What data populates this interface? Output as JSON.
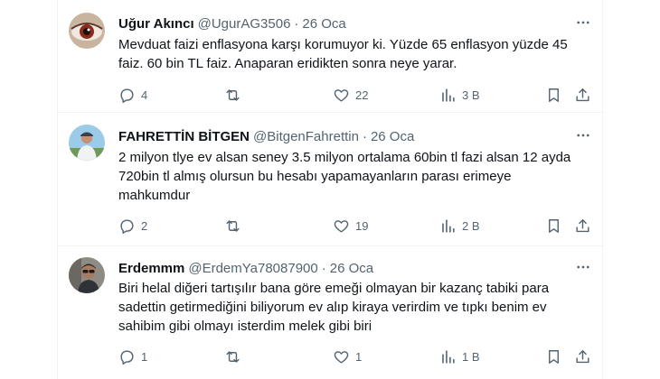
{
  "tweets": [
    {
      "name": "Uğur Akıncı",
      "handle": "@UgurAG3506",
      "time": "26 Oca",
      "text": "Mevduat faizi enflasyona karşı korumuyor ki. Yüzde 65 enflasyon yüzde 45\nfaiz. 60 bin TL faiz. Anaparan eridikten sonra neye yarar.",
      "replies": "4",
      "retweets": "",
      "likes": "22",
      "views": "3 B"
    },
    {
      "name": "FAHRETTİN BİTGEN",
      "handle": "@BitgenFahrettin",
      "time": "26 Oca",
      "text": "2 milyon tlye ev alsan seney 3.5 milyon ortalama 60bin tl fazi alsan 12 ayda\n720bin tl almış olursun bu hesabı yapamayanların parası erimeye\nmahkumdur",
      "replies": "2",
      "retweets": "",
      "likes": "19",
      "views": "2 B"
    },
    {
      "name": "Erdemmm",
      "handle": "@ErdemYa78087900",
      "time": "26 Oca",
      "text": "Biri helal diğeri tartışılır bana göre emeği olmayan bir kazanç tabiki para\nsadettin getirmediğini biliyorum ev alıp kiraya verirdim ve tıpkı  benim ev\nsahibim gibi olmayı isterdim melek gibi biri",
      "replies": "1",
      "retweets": "",
      "likes": "1",
      "views": "1 B"
    }
  ],
  "colors": {
    "text": "#0f1419",
    "secondary": "#536471",
    "divider": "#eff3f4"
  },
  "icons": {
    "reply": "speech-bubble-icon",
    "retweet": "retweet-arrows-icon",
    "like": "heart-icon",
    "views": "bar-chart-icon",
    "bookmark": "bookmark-icon",
    "share": "share-upload-icon",
    "more": "more-dots-icon"
  }
}
